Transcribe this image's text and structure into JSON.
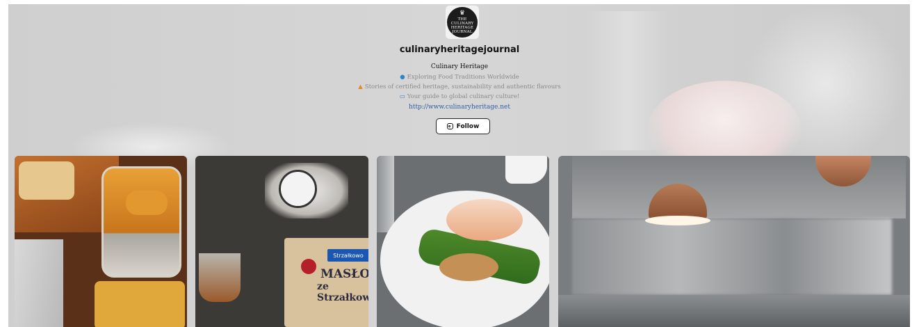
{
  "profile": {
    "username": "culinaryheritagejournal",
    "full_name": "Culinary Heritage",
    "bio_lines": [
      "Exploring Food Traditions Worldwide",
      "Stories of certified heritage, sustainability and authentic flavours",
      "Your guide to global culinary culture!"
    ],
    "website": "http://www.culinaryheritage.net",
    "follow_label": "Follow",
    "logo_text": [
      "THE",
      "CULINARY",
      "HERITAGE",
      "JOURNAL"
    ]
  },
  "posts": [
    {
      "subject": "honey"
    },
    {
      "subject": "butter",
      "brand": "Strzałkowo",
      "word1": "MASŁO",
      "word2": "ze Strzałkow"
    },
    {
      "subject": "dish"
    },
    {
      "subject": "kitchen"
    }
  ],
  "icons": {
    "globe": "globe-icon",
    "fire": "fire-icon",
    "book": "book-icon",
    "instagram": "instagram-icon"
  }
}
